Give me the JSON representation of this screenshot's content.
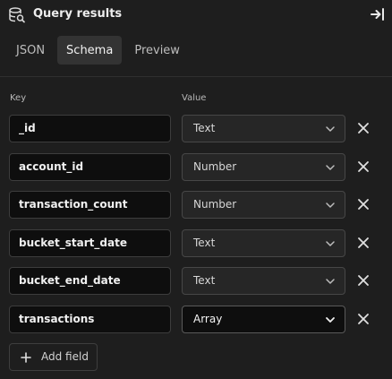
{
  "header": {
    "title": "Query results",
    "icon": "database-search-icon",
    "collapse_icon": "collapse-panel-icon"
  },
  "tabs": [
    {
      "label": "JSON",
      "active": false
    },
    {
      "label": "Schema",
      "active": true
    },
    {
      "label": "Preview",
      "active": false
    }
  ],
  "columns": {
    "key": "Key",
    "value": "Value"
  },
  "fields": [
    {
      "key": "_id",
      "type": "Text"
    },
    {
      "key": "account_id",
      "type": "Number"
    },
    {
      "key": "transaction_count",
      "type": "Number"
    },
    {
      "key": "bucket_start_date",
      "type": "Text"
    },
    {
      "key": "bucket_end_date",
      "type": "Text"
    },
    {
      "key": "transactions",
      "type": "Array"
    }
  ],
  "add_field_label": "Add field",
  "colors": {
    "background": "#1e1e1e",
    "input_bg": "#0e0e0e",
    "active_tab": "#333333"
  }
}
